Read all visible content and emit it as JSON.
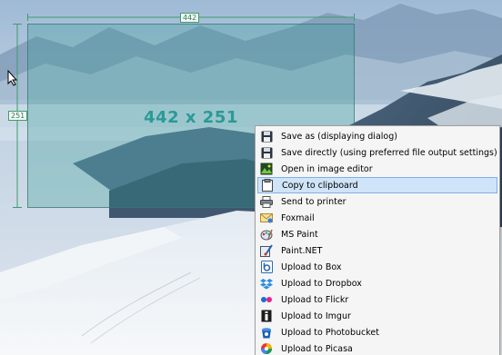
{
  "selection": {
    "width_label": "442",
    "height_label": "251",
    "size_label": "442 x 251"
  },
  "menu": {
    "items": [
      {
        "label": "Save as (displaying dialog)",
        "icon": "floppy-disk-icon",
        "highlighted": false
      },
      {
        "label": "Save directly (using preferred file output settings)",
        "icon": "floppy-disk-icon",
        "highlighted": false
      },
      {
        "label": "Open in image editor",
        "icon": "image-editor-icon",
        "highlighted": false
      },
      {
        "label": "Copy to clipboard",
        "icon": "clipboard-icon",
        "highlighted": true
      },
      {
        "label": "Send to printer",
        "icon": "printer-icon",
        "highlighted": false
      },
      {
        "label": "Foxmail",
        "icon": "foxmail-icon",
        "highlighted": false
      },
      {
        "label": "MS Paint",
        "icon": "ms-paint-icon",
        "highlighted": false
      },
      {
        "label": "Paint.NET",
        "icon": "paint-net-icon",
        "highlighted": false
      },
      {
        "label": "Upload to Box",
        "icon": "box-icon",
        "highlighted": false
      },
      {
        "label": "Upload to Dropbox",
        "icon": "dropbox-icon",
        "highlighted": false
      },
      {
        "label": "Upload to Flickr",
        "icon": "flickr-icon",
        "highlighted": false
      },
      {
        "label": "Upload to Imgur",
        "icon": "imgur-icon",
        "highlighted": false
      },
      {
        "label": "Upload to Photobucket",
        "icon": "photobucket-icon",
        "highlighted": false
      },
      {
        "label": "Upload to Picasa",
        "icon": "picasa-icon",
        "highlighted": false
      }
    ]
  },
  "colors": {
    "highlight": "#cfe4f8",
    "highlight_border": "#7fb0e6",
    "selection_text": "#2a9a96",
    "dimension_tag": "#3b9e6a"
  }
}
